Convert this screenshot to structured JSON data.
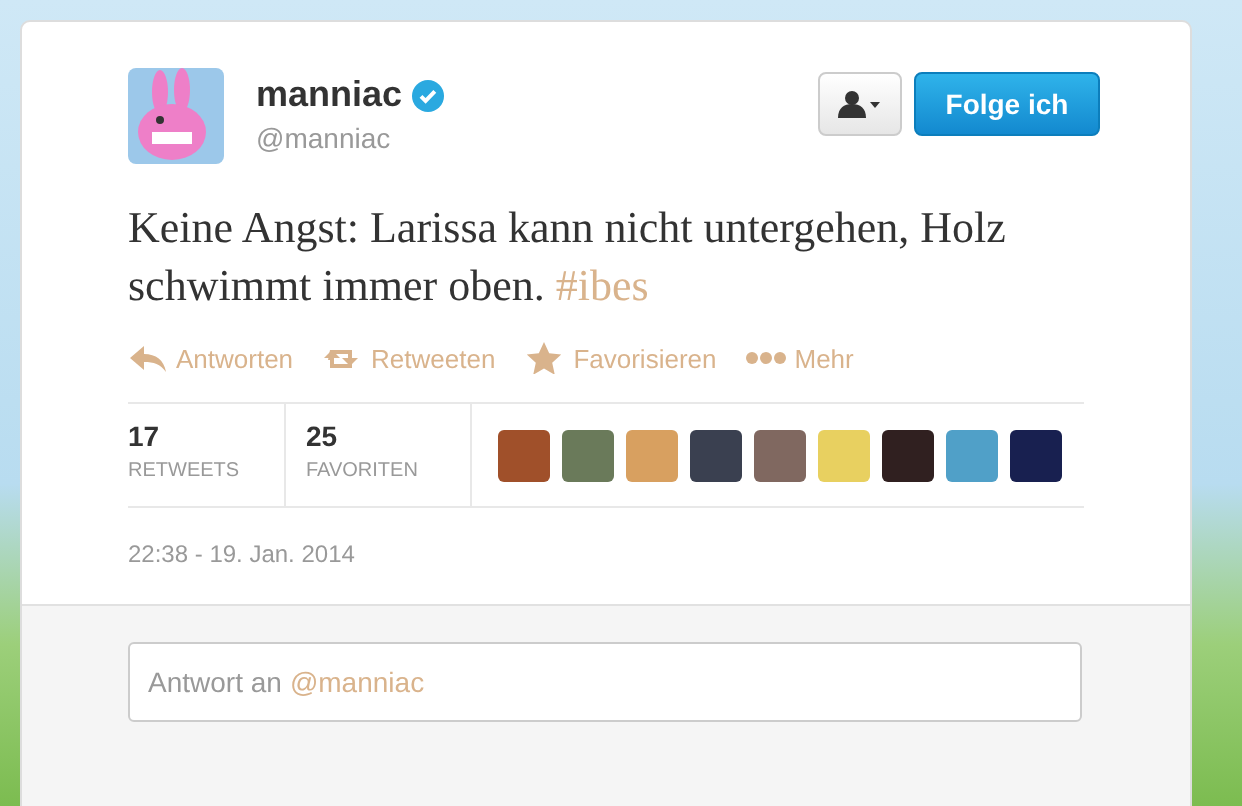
{
  "tweet": {
    "display_name": "manniac",
    "verified": true,
    "handle": "@manniac",
    "follow_button": "Folge ich",
    "text": "Keine Angst: Larissa kann nicht untergehen, Holz schwimmt immer oben.",
    "hashtag": "#ibes",
    "actions": [
      {
        "kind": "reply",
        "label": "Antworten"
      },
      {
        "kind": "retweet",
        "label": "Retweeten"
      },
      {
        "kind": "favorite",
        "label": "Favorisieren"
      },
      {
        "kind": "more",
        "label": "Mehr"
      }
    ],
    "stats": [
      {
        "count": "17",
        "label": "RETWEETS"
      },
      {
        "count": "25",
        "label": "FAVORITEN"
      }
    ],
    "favoriters": [
      {
        "kind": "photo"
      },
      {
        "kind": "photo"
      },
      {
        "kind": "photo"
      },
      {
        "kind": "photo"
      },
      {
        "kind": "photo"
      },
      {
        "kind": "photo"
      },
      {
        "kind": "photo"
      },
      {
        "kind": "photo"
      },
      {
        "kind": "photo"
      }
    ],
    "timestamp": "22:38 - 19. Jan. 2014"
  },
  "reply_field": {
    "placeholder": "Antwort an",
    "mention": "@manniac"
  }
}
